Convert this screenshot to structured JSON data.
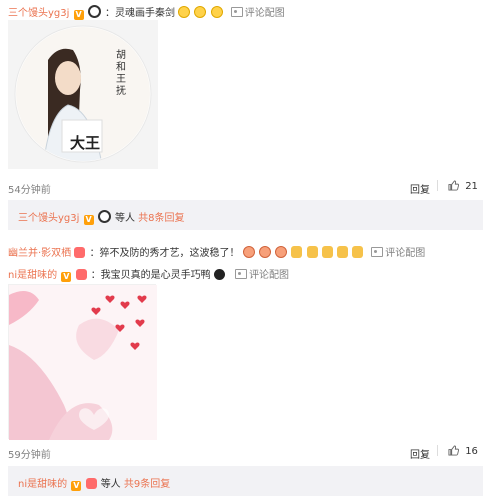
{
  "comment1": {
    "username": "三个馒头yg3j",
    "text": "：灵魂画手秦剑",
    "view_pic": "评论配图",
    "time": "54分钟前",
    "reply_label": "回复",
    "like_count": "21",
    "image_caption": "大王",
    "image_text": "胡 和 王 抚"
  },
  "comment1_replies": {
    "username": "三个馒头yg3j",
    "suffix": "等人",
    "count_text": "共8条回复"
  },
  "comment2": {
    "username": "幽兰并·影双栖",
    "text": "：猝不及防的秀才艺，这波稳了！",
    "view_pic": "评论配图"
  },
  "comment3": {
    "username": "ni是甜味的",
    "text": "：我宝贝真的是心灵手巧鸭",
    "view_pic": "评论配图",
    "time": "59分钟前",
    "reply_label": "回复",
    "like_count": "16"
  },
  "comment3_replies": {
    "username": "ni是甜味的",
    "suffix": "等人",
    "count_text": "共9条回复"
  },
  "colors": {
    "accent": "#eb7350",
    "muted": "#808080",
    "reply_bg": "#f2f2f5"
  }
}
